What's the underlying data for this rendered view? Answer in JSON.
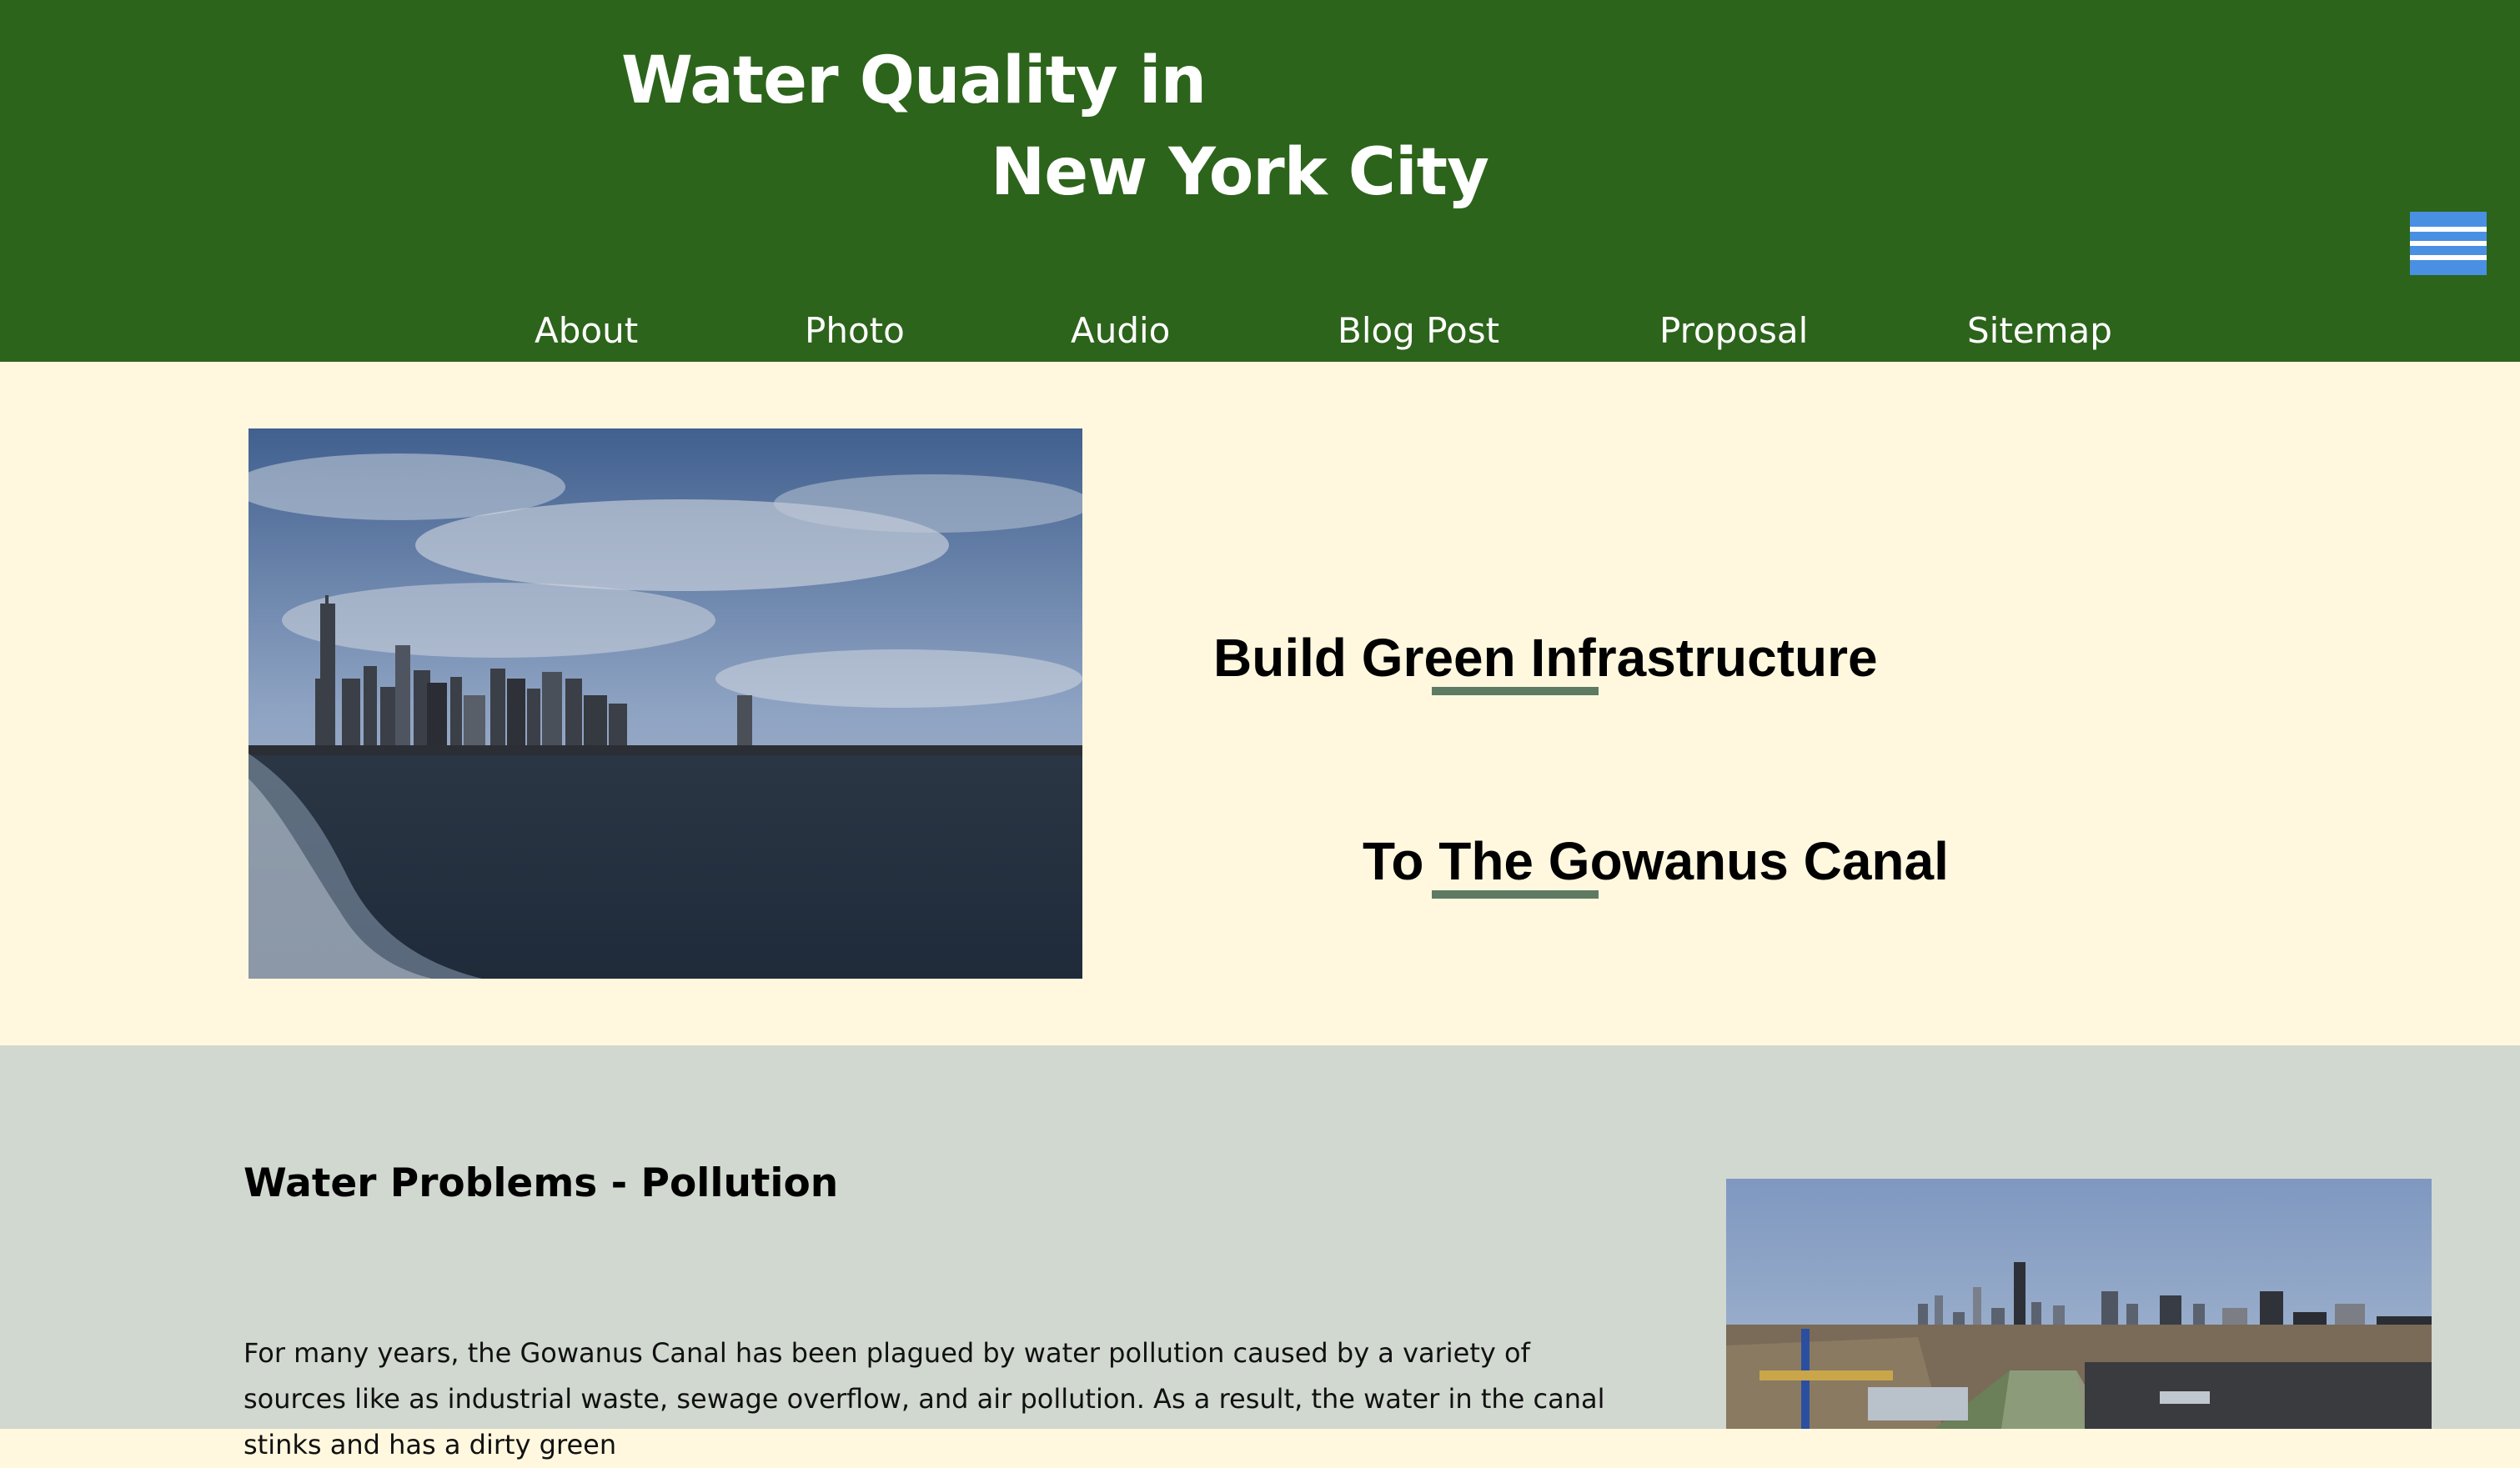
{
  "header": {
    "title_line1": "Water Quality in",
    "title_line2": "New York City",
    "menu_icon": "hamburger-menu-icon"
  },
  "nav": {
    "items": [
      "About",
      "Photo",
      "Audio",
      "Blog Post",
      "Proposal",
      "Sitemap"
    ]
  },
  "hero": {
    "headline_line1": "Build Green Infrastructure",
    "headline_line2": "To The Gowanus Canal"
  },
  "section": {
    "title": "Water Problems - Pollution",
    "body": "For many years, the Gowanus Canal has been plagued by water pollution caused by a variety of sources like as industrial waste, sewage overflow, and air pollution. As a result, the water in the canal stinks and has a dirty green"
  },
  "colors": {
    "header_bg": "#2c641b",
    "hero_bg": "#fff8df",
    "section_bg": "#d1d8d0",
    "accent_underline": "#5f7a62",
    "menu_button": "#4a90e2"
  }
}
